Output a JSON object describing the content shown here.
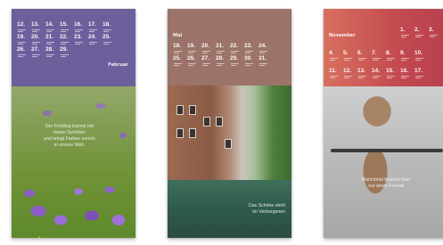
{
  "cards": [
    {
      "month": "Februar",
      "rows": [
        [
          "12.",
          "13.",
          "14.",
          "15.",
          "16.",
          "17.",
          "18."
        ],
        [
          "19.",
          "20.",
          "21.",
          "22.",
          "23.",
          "24.",
          "25."
        ],
        [
          "26.",
          "27.",
          "28.",
          "29."
        ]
      ],
      "quote": [
        "Der Frühling kommt mit",
        "leisen Schritten",
        "und bringt Farben zurück",
        "in unsere Welt."
      ],
      "accent": "#6c5f9c"
    },
    {
      "month": "Mai",
      "rows": [
        [
          "18.",
          "19.",
          "20.",
          "21.",
          "22.",
          "23.",
          "24."
        ],
        [
          "25.",
          "26.",
          "27.",
          "28.",
          "29.",
          "30.",
          "31."
        ]
      ],
      "quote": [
        "Das Schöne steht",
        "im Verborgenen"
      ],
      "accent": "#9b7368"
    },
    {
      "month": "November",
      "rows": [
        [
          "1.",
          "2.",
          "3."
        ],
        [
          "4.",
          "5.",
          "6.",
          "7.",
          "8.",
          "9.",
          "10."
        ],
        [
          "11.",
          "12.",
          "13.",
          "14.",
          "15.",
          "16.",
          "17."
        ]
      ],
      "quote": [
        "Manchmal braucht man",
        "nur einen Freund"
      ],
      "accent": "#c34a50"
    }
  ]
}
